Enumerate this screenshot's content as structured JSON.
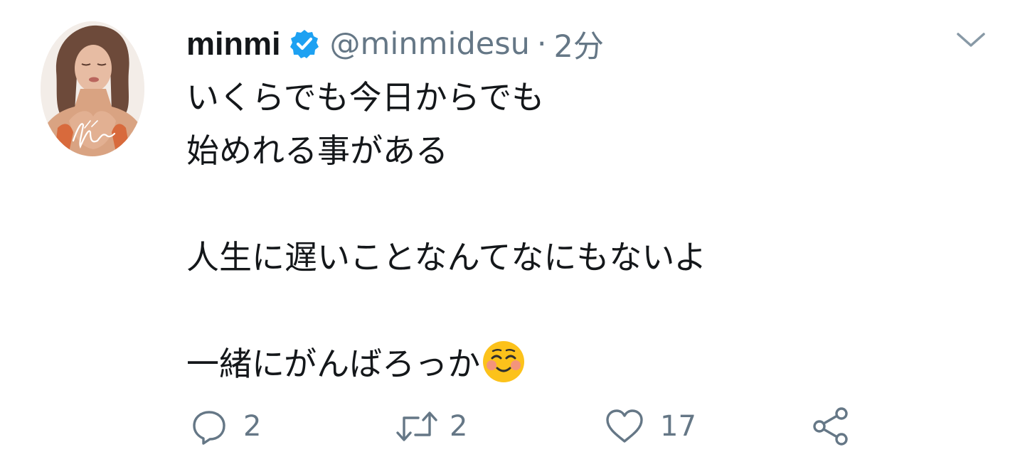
{
  "user": {
    "display_name": "minmi",
    "handle": "@minmidesu",
    "separator": "·",
    "time": "2分",
    "verified": true,
    "avatar_signature": "Min"
  },
  "tweet": {
    "lines": [
      "いくらでも今日からでも",
      "始めれる事がある",
      "",
      "人生に遅いことなんてなにもないよ",
      "",
      "一緒にがんばろっか"
    ],
    "emoji": "smiling-face-with-blush"
  },
  "actions": {
    "reply_count": "2",
    "retweet_count": "2",
    "like_count": "17"
  },
  "colors": {
    "text": "#14171a",
    "secondary": "#657786",
    "verified_blue": "#1da1f2",
    "icon_gray": "#657786"
  },
  "icons": [
    "verified-badge-icon",
    "chevron-down-icon",
    "reply-icon",
    "retweet-icon",
    "like-icon",
    "share-icon"
  ]
}
